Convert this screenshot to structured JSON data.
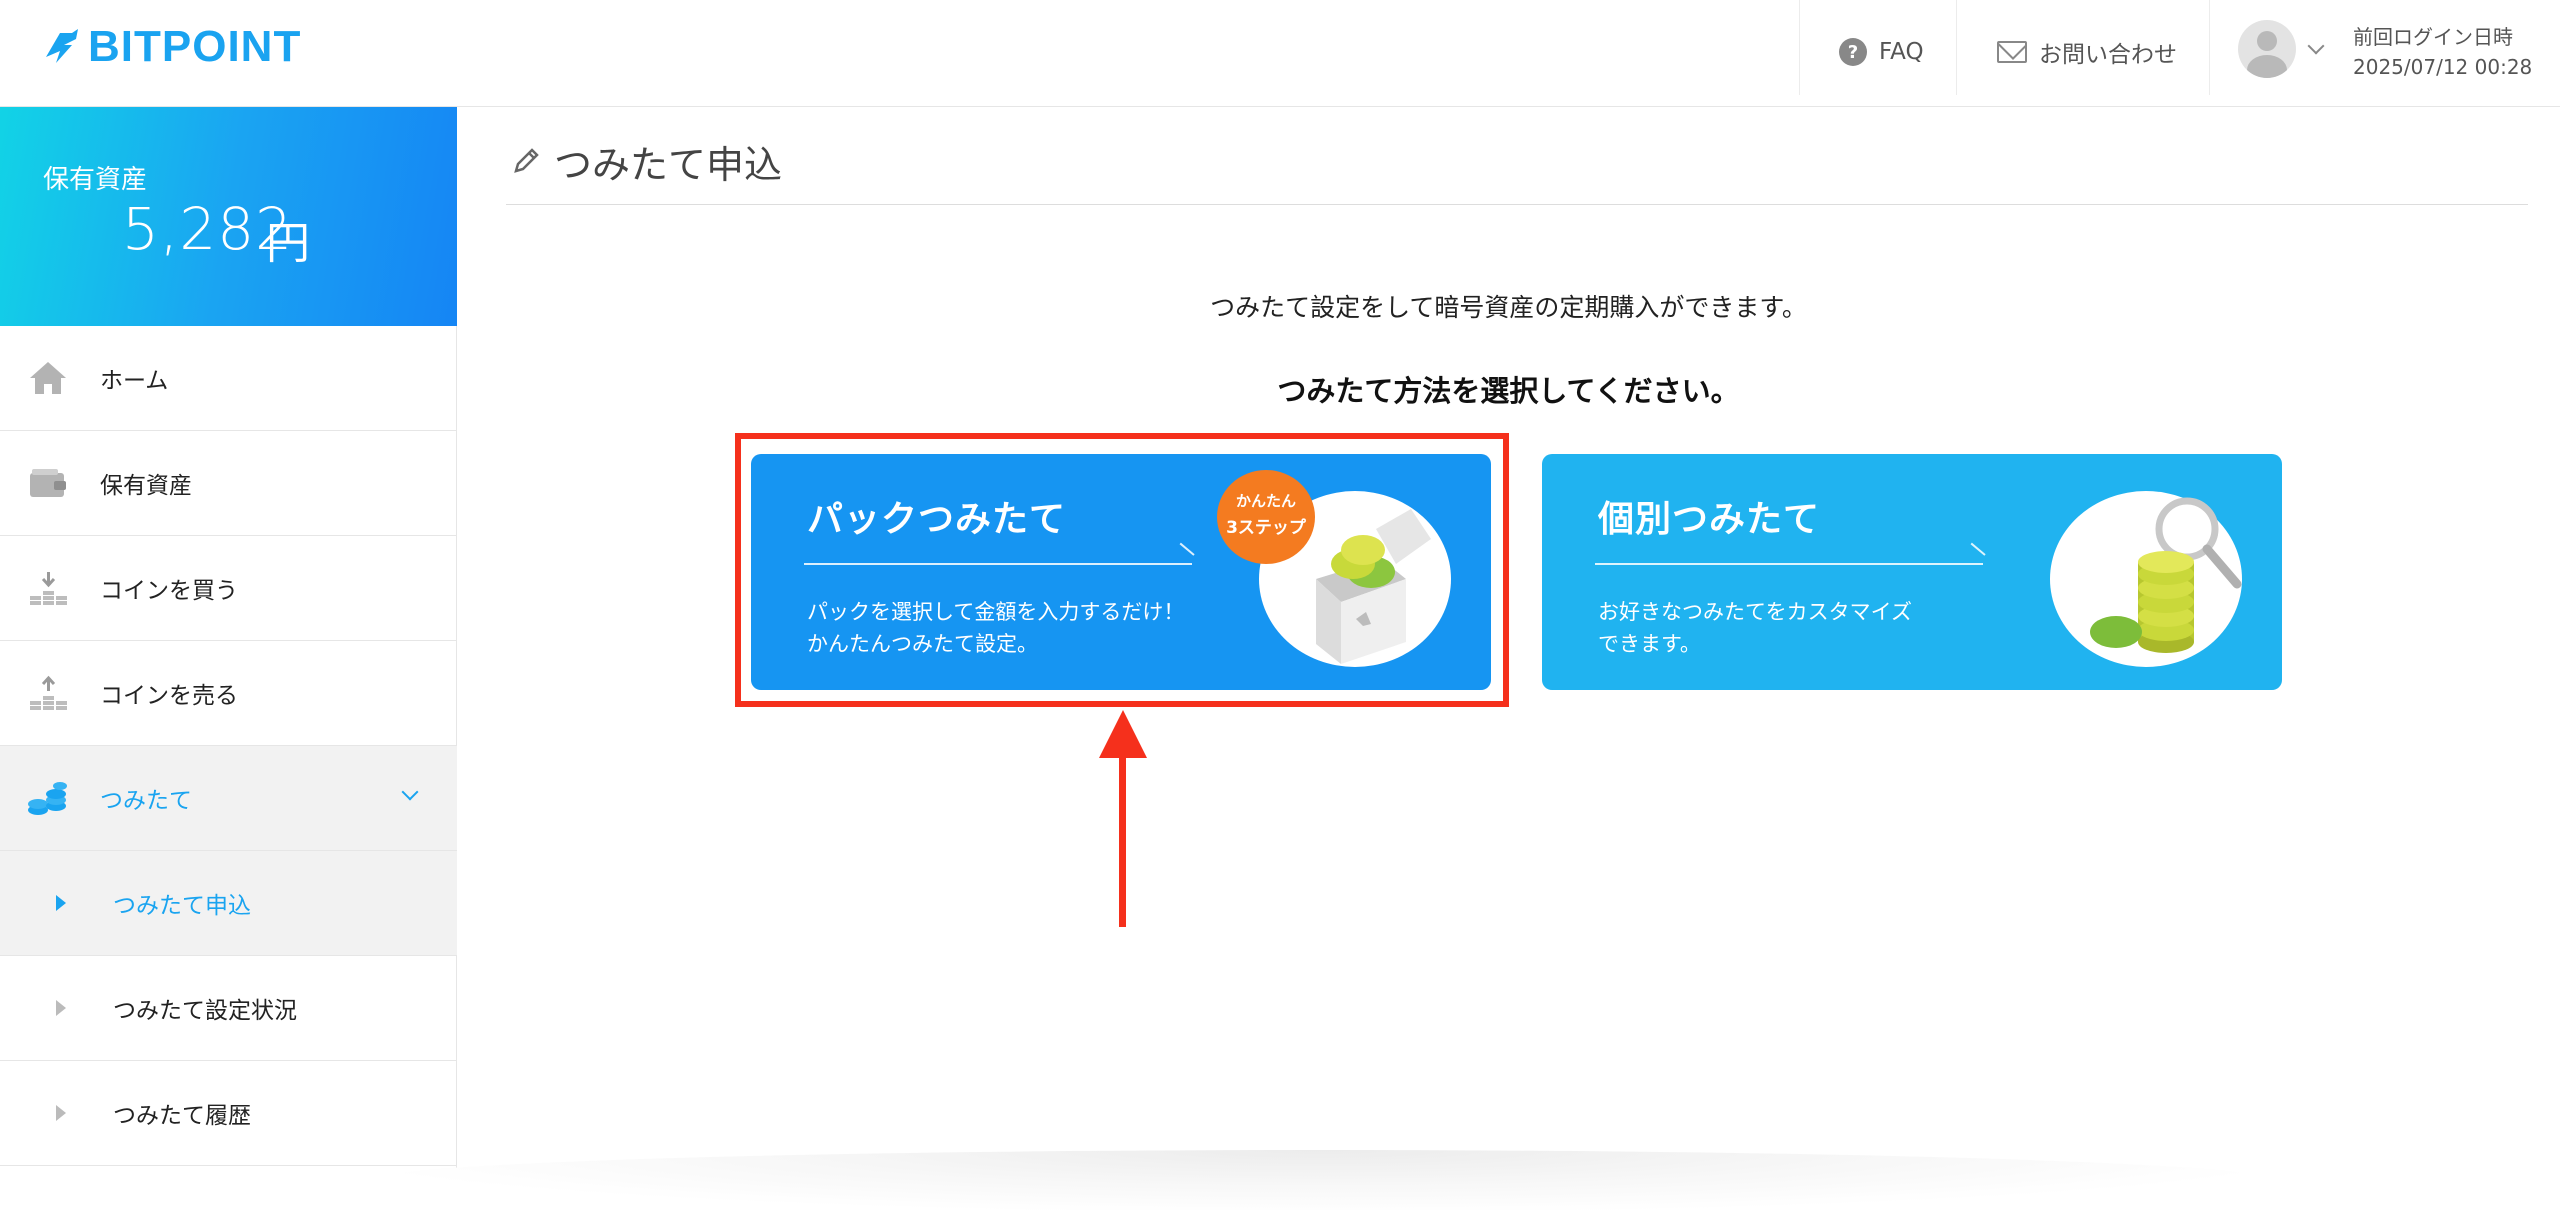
{
  "brand": {
    "logo_text": "BITPOINT",
    "accent": "#1aa4f0"
  },
  "header": {
    "faq_label": "FAQ",
    "contact_label": "お問い合わせ",
    "last_login_label": "前回ログイン日時",
    "last_login_time": "2025/07/12 00:28"
  },
  "sidebar": {
    "asset_label": "保有資産",
    "asset_value": "5,282",
    "asset_unit": "円",
    "items": [
      {
        "label": "ホーム",
        "icon": "home-icon"
      },
      {
        "label": "保有資産",
        "icon": "wallet-icon"
      },
      {
        "label": "コインを買う",
        "icon": "buy-coin-icon"
      },
      {
        "label": "コインを売る",
        "icon": "sell-coin-icon"
      },
      {
        "label": "つみたて",
        "icon": "coins-stack-icon",
        "active": true
      }
    ],
    "sub_items": [
      {
        "label": "つみたて申込",
        "active": true
      },
      {
        "label": "つみたて設定状況"
      },
      {
        "label": "つみたて履歴"
      }
    ]
  },
  "main": {
    "page_title": "つみたて申込",
    "intro": "つみたて設定をして暗号資産の定期購入ができます。",
    "select_prompt": "つみたて方法を選択してください。",
    "cards": [
      {
        "title": "パックつみたて",
        "desc_line1": "パックを選択して金額を入力するだけ！",
        "desc_line2": "かんたんつみたて設定。",
        "badge_line1": "かんたん",
        "badge_line2": "3ステップ",
        "color": "#1695f2"
      },
      {
        "title": "個別つみたて",
        "desc_line1": "お好きなつみたてをカスタマイズ",
        "desc_line2": "できます。",
        "color": "#20b3f0"
      }
    ]
  },
  "annotation": {
    "highlight_color": "#f5301c"
  }
}
